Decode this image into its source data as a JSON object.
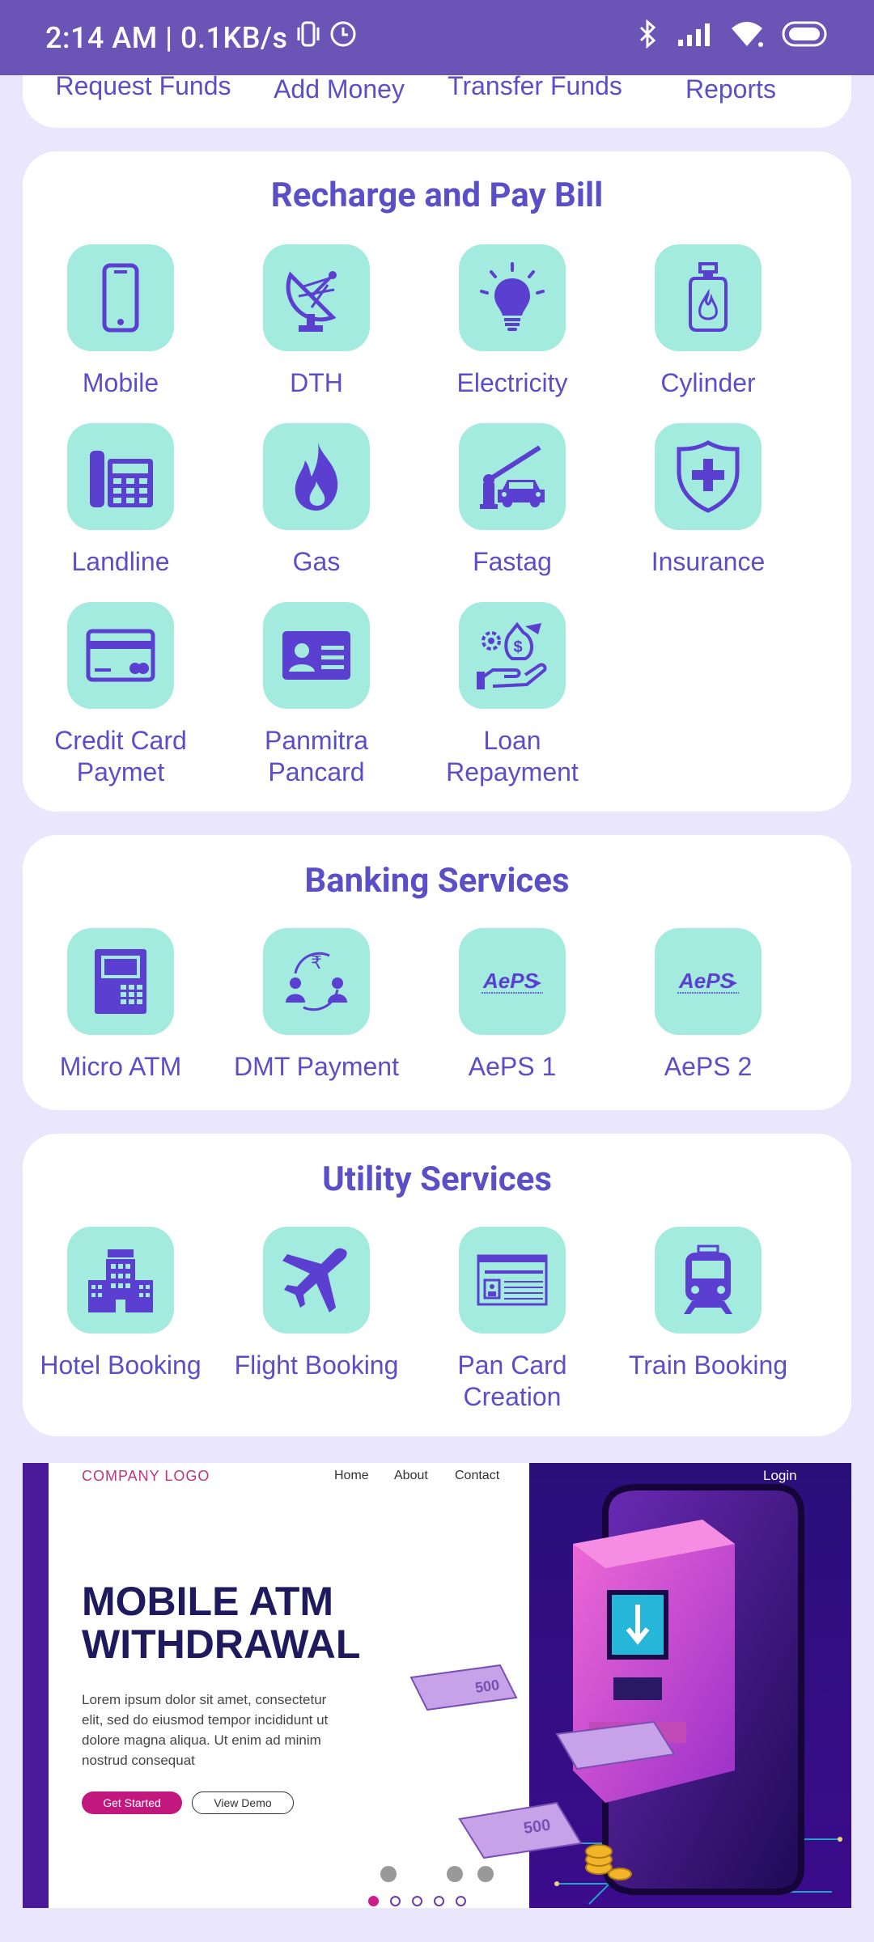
{
  "status_bar": {
    "time_speed": "2:14 AM | 0.1KB/s"
  },
  "top_card": {
    "labels": [
      "Request Funds",
      "Add Money",
      "Transfer Funds",
      "Reports"
    ]
  },
  "recharge": {
    "title": "Recharge and Pay Bill",
    "items": [
      {
        "label": "Mobile",
        "icon": "mobile-icon"
      },
      {
        "label": "DTH",
        "icon": "satellite-dish-icon"
      },
      {
        "label": "Electricity",
        "icon": "bulb-icon"
      },
      {
        "label": "Cylinder",
        "icon": "cylinder-icon"
      },
      {
        "label": "Landline",
        "icon": "landline-phone-icon"
      },
      {
        "label": "Gas",
        "icon": "flame-icon"
      },
      {
        "label": "Fastag",
        "icon": "toll-car-icon"
      },
      {
        "label": "Insurance",
        "icon": "shield-plus-icon"
      },
      {
        "label": "Credit Card Paymet",
        "icon": "credit-card-icon"
      },
      {
        "label": "Panmitra Pancard",
        "icon": "id-card-icon"
      },
      {
        "label": "Loan Repayment",
        "icon": "loan-hand-icon"
      }
    ]
  },
  "banking": {
    "title": "Banking Services",
    "items": [
      {
        "label": "Micro ATM",
        "icon": "atm-icon"
      },
      {
        "label": "DMT Payment",
        "icon": "money-transfer-icon"
      },
      {
        "label": "AePS 1",
        "icon": "aeps-logo-icon",
        "logo_text": "AePS"
      },
      {
        "label": "AePS 2",
        "icon": "aeps-logo-icon",
        "logo_text": "AePS"
      }
    ]
  },
  "utility": {
    "title": "Utility Services",
    "items": [
      {
        "label": "Hotel Booking",
        "icon": "hotel-icon"
      },
      {
        "label": "Flight Booking",
        "icon": "airplane-icon"
      },
      {
        "label": "Pan Card Creation",
        "icon": "pan-card-icon"
      },
      {
        "label": "Train Booking",
        "icon": "train-icon"
      }
    ]
  },
  "banner": {
    "logo": "COMPANY LOGO",
    "nav": [
      "Home",
      "About",
      "Contact"
    ],
    "login": "Login",
    "headline_1": "MOBILE ATM",
    "headline_2": "WITHDRAWAL",
    "body_1": "Lorem ipsum dolor sit amet, consectetur",
    "body_2": "elit, sed do eiusmod tempor incididunt ut",
    "body_3": "dolore magna aliqua. Ut enim ad minim",
    "body_4": "nostrud consequat",
    "cta_primary": "Get Started",
    "cta_secondary": "View Demo",
    "note_500": "500",
    "slides_total": 5,
    "slide_active": 1
  },
  "colors": {
    "status_bar": "#6A55B6",
    "background": "#EAE6FB",
    "accent": "#5B4FC8",
    "tile": "#A3EBDE",
    "banner_pink": "#D11B8C"
  }
}
